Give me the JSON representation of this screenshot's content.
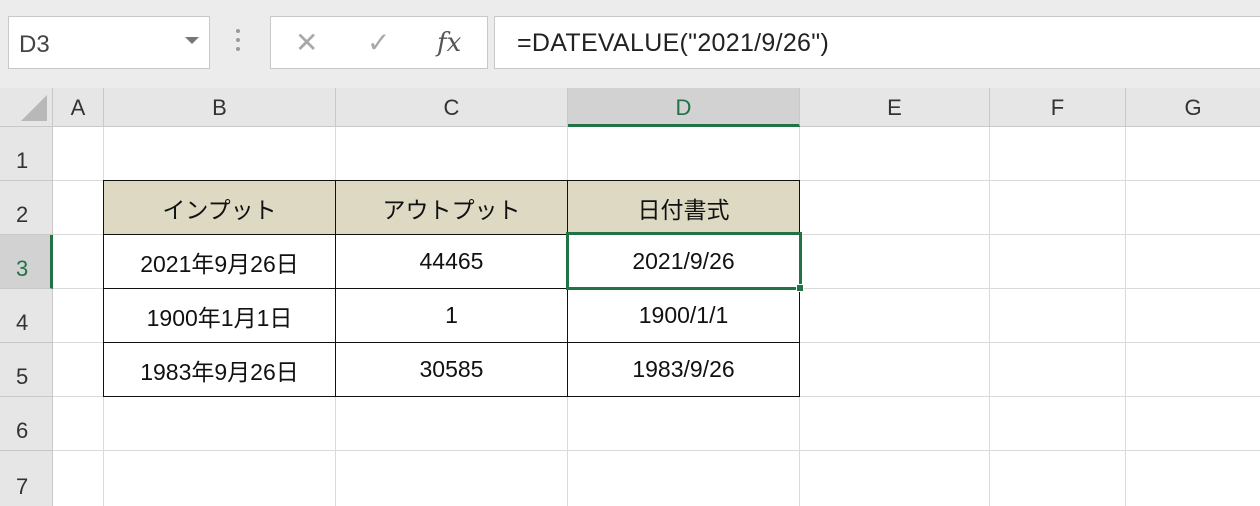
{
  "name_box": {
    "value": "D3"
  },
  "formula_bar": {
    "cancel_glyph": "✕",
    "enter_glyph": "✓",
    "fx_label": "fx",
    "formula": "=DATEVALUE(\"2021/9/26\")"
  },
  "columns": [
    "A",
    "B",
    "C",
    "D",
    "E",
    "F",
    "G"
  ],
  "rows": [
    "1",
    "2",
    "3",
    "4",
    "5",
    "6",
    "7"
  ],
  "active_cell": {
    "column": "D",
    "row": "3"
  },
  "table": {
    "headers": [
      "インプット",
      "アウトプット",
      "日付書式"
    ],
    "rows": [
      [
        "2021年9月26日",
        "44465",
        "2021/9/26"
      ],
      [
        "1900年1月1日",
        "1",
        "1900/1/1"
      ],
      [
        "1983年9月26日",
        "30585",
        "1983/9/26"
      ]
    ],
    "header_fill": "#ddd9c3"
  },
  "colors": {
    "accent": "#217346",
    "grid_line": "#dadada",
    "header_bg": "#e6e6e6"
  }
}
